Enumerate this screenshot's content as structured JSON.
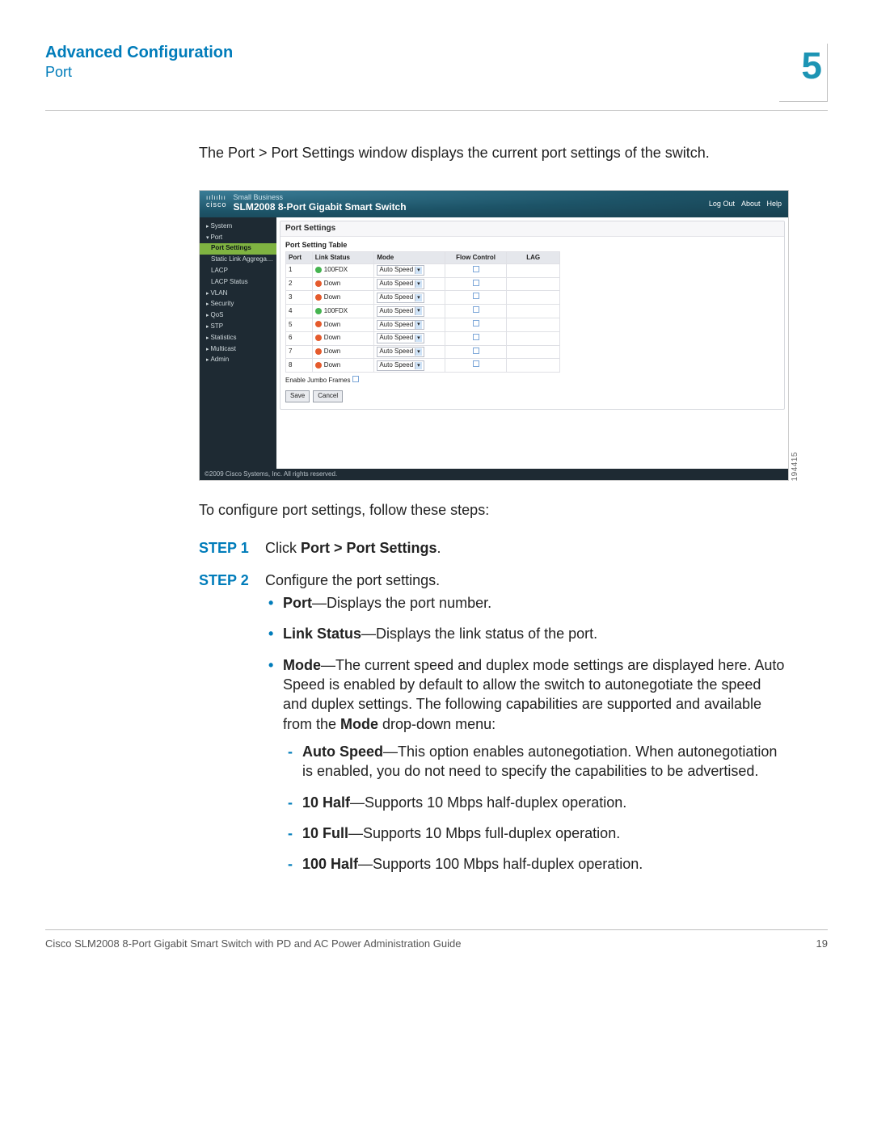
{
  "header": {
    "title": "Advanced Configuration",
    "subtitle": "Port",
    "chapter_number": "5"
  },
  "content": {
    "intro": "The Port > Port Settings window displays the current port settings of the switch.",
    "after_image": "To configure port settings, follow these steps:"
  },
  "screenshot": {
    "brand": "cisco",
    "brand_wave": "ıılıılıı",
    "small_title": "Small Business",
    "device_title": "SLM2008 8-Port Gigabit Smart Switch",
    "header_links": [
      "Log Out",
      "About",
      "Help"
    ],
    "nav": [
      {
        "label": "System",
        "lvl": 1,
        "exp": true
      },
      {
        "label": "Port",
        "lvl": 1,
        "open": true
      },
      {
        "label": "Port Settings",
        "lvl": 2,
        "active": true
      },
      {
        "label": "Static Link Aggregation",
        "lvl": 2
      },
      {
        "label": "LACP",
        "lvl": 2
      },
      {
        "label": "LACP Status",
        "lvl": 2
      },
      {
        "label": "VLAN",
        "lvl": 1,
        "exp": true
      },
      {
        "label": "Security",
        "lvl": 1,
        "exp": true
      },
      {
        "label": "QoS",
        "lvl": 1,
        "exp": true
      },
      {
        "label": "STP",
        "lvl": 1,
        "exp": true
      },
      {
        "label": "Statistics",
        "lvl": 1,
        "exp": true
      },
      {
        "label": "Multicast",
        "lvl": 1,
        "exp": true
      },
      {
        "label": "Admin",
        "lvl": 1,
        "exp": true
      }
    ],
    "panel_title": "Port Settings",
    "table_title": "Port Setting Table",
    "columns": [
      "Port",
      "Link Status",
      "Mode",
      "Flow Control",
      "LAG"
    ],
    "rows": [
      {
        "port": "1",
        "status": "100FDX",
        "up": true,
        "mode": "Auto Speed"
      },
      {
        "port": "2",
        "status": "Down",
        "up": false,
        "mode": "Auto Speed"
      },
      {
        "port": "3",
        "status": "Down",
        "up": false,
        "mode": "Auto Speed"
      },
      {
        "port": "4",
        "status": "100FDX",
        "up": true,
        "mode": "Auto Speed"
      },
      {
        "port": "5",
        "status": "Down",
        "up": false,
        "mode": "Auto Speed"
      },
      {
        "port": "6",
        "status": "Down",
        "up": false,
        "mode": "Auto Speed"
      },
      {
        "port": "7",
        "status": "Down",
        "up": false,
        "mode": "Auto Speed"
      },
      {
        "port": "8",
        "status": "Down",
        "up": false,
        "mode": "Auto Speed"
      }
    ],
    "jumbo_label": "Enable Jumbo Frames",
    "buttons": [
      "Save",
      "Cancel"
    ],
    "footer": "©2009 Cisco Systems, Inc. All rights reserved.",
    "image_id": "194415"
  },
  "steps": {
    "s1_label": "STEP 1",
    "s1_pre": "Click ",
    "s1_bold": "Port > Port Settings",
    "s1_post": ".",
    "s2_label": "STEP 2",
    "s2_text": "Configure the port settings.",
    "bullets1": [
      {
        "bold": "Port",
        "rest": "—Displays the port number."
      },
      {
        "bold": "Link Status",
        "rest": "—Displays the link status of the port."
      },
      {
        "bold": "Mode",
        "rest": "—The current speed and duplex mode settings are displayed here. Auto Speed is enabled by default to allow the switch to autonegotiate the speed and duplex settings. The following capabilities are supported and available from the ",
        "bold2": "Mode",
        "rest2": " drop-down menu:"
      }
    ],
    "bullets2": [
      {
        "bold": "Auto Speed",
        "rest": "—This option enables autonegotiation. When autonegotiation is enabled, you do not need to specify the capabilities to be advertised."
      },
      {
        "bold": "10 Half",
        "rest": "—Supports 10 Mbps half-duplex operation."
      },
      {
        "bold": "10 Full",
        "rest": "—Supports 10 Mbps full-duplex operation."
      },
      {
        "bold": "100 Half",
        "rest": "—Supports 100 Mbps half-duplex operation."
      }
    ]
  },
  "footer": {
    "doc_title": "Cisco SLM2008 8-Port Gigabit Smart Switch with PD and AC Power Administration Guide",
    "page_num": "19"
  }
}
